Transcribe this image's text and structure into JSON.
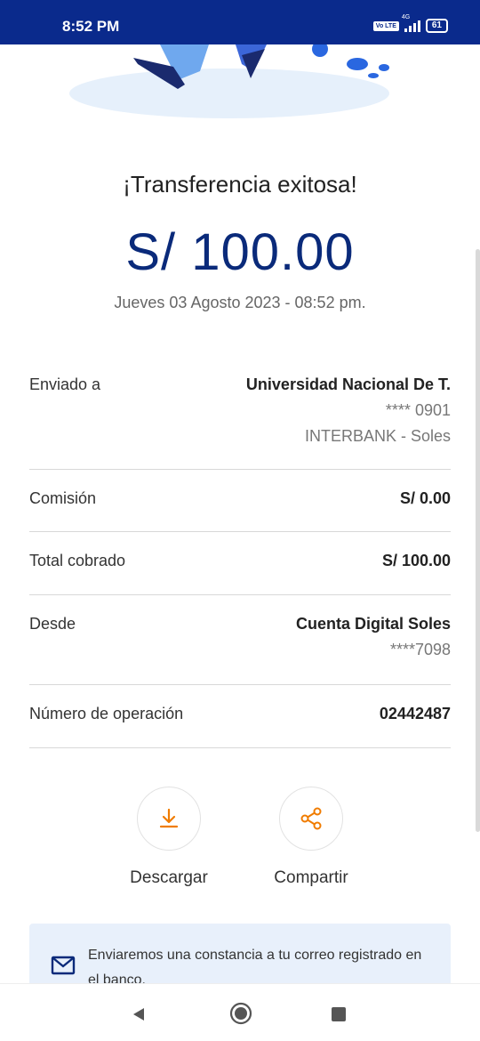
{
  "status_bar": {
    "time": "8:52 PM",
    "volte": "Vo LTE",
    "network": "4G",
    "battery": "61"
  },
  "title": "¡Transferencia exitosa!",
  "amount": "S/ 100.00",
  "datetime": "Jueves 03 Agosto 2023 - 08:52 pm.",
  "details": {
    "sent_to": {
      "label": "Enviado a",
      "name": "Universidad Nacional De T.",
      "account": "**** 0901",
      "bank": "INTERBANK - Soles"
    },
    "commission": {
      "label": "Comisión",
      "value": "S/ 0.00"
    },
    "total": {
      "label": "Total cobrado",
      "value": "S/ 100.00"
    },
    "from": {
      "label": "Desde",
      "account_name": "Cuenta Digital Soles",
      "account_number": "****7098"
    },
    "operation": {
      "label": "Número de operación",
      "value": "02442487"
    }
  },
  "actions": {
    "download_label": "Descargar",
    "share_label": "Compartir"
  },
  "notice": {
    "text": "Enviaremos una constancia a tu correo registrado en el banco."
  },
  "colors": {
    "status_bar": "#0a2a8c",
    "amount": "#0a2a7a",
    "action_icon": "#f07c00",
    "notice_bg": "#e8f0fb"
  }
}
